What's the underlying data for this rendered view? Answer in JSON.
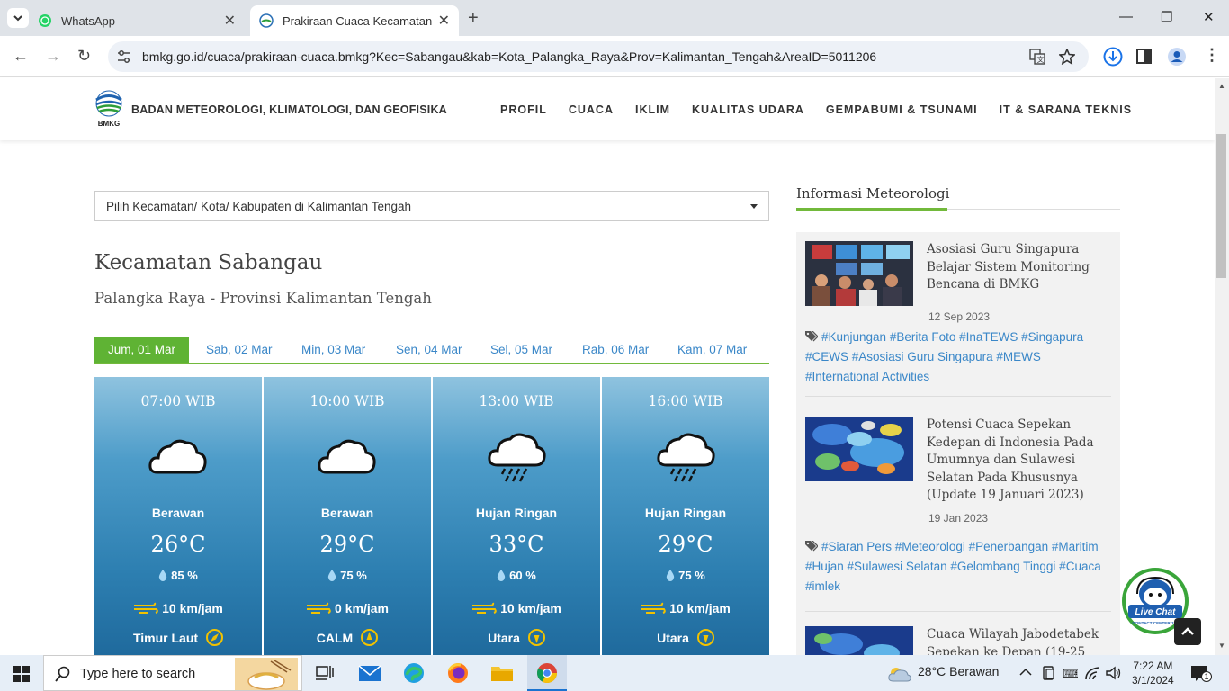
{
  "browser": {
    "tabs": [
      {
        "title": "WhatsApp",
        "icon": "whatsapp-icon"
      },
      {
        "title": "Prakiraan Cuaca Kecamatan Sab",
        "icon": "bmkg-icon"
      }
    ],
    "url": "bmkg.go.id/cuaca/prakiraan-cuaca.bmkg?Kec=Sabangau&kab=Kota_Palangka_Raya&Prov=Kalimantan_Tengah&AreaID=5011206"
  },
  "header": {
    "logo_text": "BMKG",
    "org_name": "BADAN METEOROLOGI, KLIMATOLOGI, DAN GEOFISIKA",
    "nav": [
      "PROFIL",
      "CUACA",
      "IKLIM",
      "KUALITAS UDARA",
      "GEMPABUMI & TSUNAMI",
      "IT & SARANA TEKNIS"
    ]
  },
  "main": {
    "selector_placeholder": "Pilih Kecamatan/ Kota/ Kabupaten di Kalimantan Tengah",
    "title": "Kecamatan Sabangau",
    "subtitle": "Palangka Raya - Provinsi Kalimantan Tengah",
    "day_tabs": [
      "Jum, 01 Mar",
      "Sab, 02 Mar",
      "Min, 03 Mar",
      "Sen, 04 Mar",
      "Sel, 05 Mar",
      "Rab, 06 Mar",
      "Kam, 07 Mar"
    ],
    "active_day": "Jum, 01 Mar",
    "forecasts": [
      {
        "time": "07:00 WIB",
        "icon": "cloudy-icon",
        "condition": "Berawan",
        "temp": "26°C",
        "humidity": "85 %",
        "wind": "10 km/jam",
        "direction": "Timur Laut"
      },
      {
        "time": "10:00 WIB",
        "icon": "cloudy-icon",
        "condition": "Berawan",
        "temp": "29°C",
        "humidity": "75 %",
        "wind": "0 km/jam",
        "direction": "CALM"
      },
      {
        "time": "13:00 WIB",
        "icon": "light-rain-icon",
        "condition": "Hujan Ringan",
        "temp": "33°C",
        "humidity": "60 %",
        "wind": "10 km/jam",
        "direction": "Utara"
      },
      {
        "time": "16:00 WIB",
        "icon": "light-rain-icon",
        "condition": "Hujan Ringan",
        "temp": "29°C",
        "humidity": "75 %",
        "wind": "10 km/jam",
        "direction": "Utara"
      }
    ]
  },
  "sidebar": {
    "heading": "Informasi Meteorologi",
    "news": [
      {
        "title": "Asosiasi Guru Singapura Belajar Sistem Monitoring Bencana di BMKG",
        "date": "12 Sep 2023",
        "tags": "#Kunjungan #Berita Foto #InaTEWS #Singapura #CEWS #Asosiasi Guru Singapura #MEWS #International Activities"
      },
      {
        "title": "Potensi Cuaca Sepekan Kedepan di Indonesia Pada Umumnya dan Sulawesi Selatan Pada Khususnya (Update 19 Januari 2023)",
        "date": "19 Jan 2023",
        "tags": "#Siaran Pers #Meteorologi #Penerbangan #Maritim #Hujan #Sulawesi Selatan #Gelombang Tinggi #Cuaca #imlek"
      },
      {
        "title": "Cuaca Wilayah Jabodetabek Sepekan ke Depan (19-25",
        "date": "",
        "tags": ""
      }
    ],
    "livechat_label": "Live Chat",
    "livechat_sub": "CONTACT CENTER 196"
  },
  "taskbar": {
    "search_placeholder": "Type here to search",
    "weather": "28°C  Berawan",
    "time": "7:22 AM",
    "date": "3/1/2024",
    "notifications": "1"
  },
  "colors": {
    "accent_green": "#5fb334",
    "link_blue": "#3a87c8",
    "card_blue": "#2d7fb1"
  }
}
